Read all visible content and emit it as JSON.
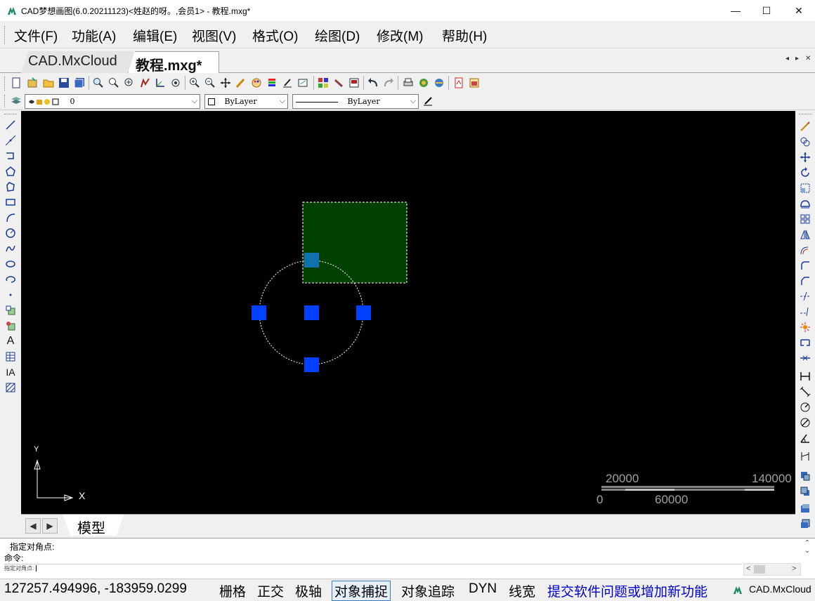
{
  "window": {
    "title": "CAD梦想画图(6.0.20211123)<姓赵的呀。,会员1> - 教程.mxg*",
    "controls": {
      "minimize": "—",
      "maximize": "☐",
      "close": "✕"
    }
  },
  "menu": {
    "items": [
      {
        "label": "文件(F)"
      },
      {
        "label": "功能(A)"
      },
      {
        "label": "编辑(E)"
      },
      {
        "label": "视图(V)"
      },
      {
        "label": "格式(O)"
      },
      {
        "label": "绘图(D)"
      },
      {
        "label": "修改(M)"
      },
      {
        "label": "帮助(H)"
      }
    ]
  },
  "tabs": {
    "items": [
      {
        "label": "CAD.MxCloud",
        "active": false
      },
      {
        "label": "教程.mxg*",
        "active": true
      }
    ],
    "nav": {
      "prev": "◂",
      "next": "▸",
      "close": "✕"
    }
  },
  "properties": {
    "layer": "0",
    "color": "ByLayer",
    "linetype": "ByLayer"
  },
  "canvas": {
    "background": "#000000",
    "rect_fill": "#004000",
    "grip_color": "#0040ff",
    "grip_hot_color": "#1070b0",
    "ucs": {
      "x_label": "X",
      "y_label": "Y"
    },
    "scale": {
      "top_labels": [
        "20000",
        "140000"
      ],
      "bottom_labels": [
        "0",
        "60000"
      ]
    }
  },
  "bottom": {
    "model_tab": "模型",
    "prev": "◀",
    "next": "▶"
  },
  "command": {
    "lines": [
      "指定对角点:",
      "命令:"
    ],
    "input_prompt": "指定对角点:"
  },
  "status": {
    "coords": "127257.494996,  -183959.0299",
    "toggles": [
      "栅格",
      "正交",
      "极轴",
      "对象捕捉",
      "对象追踪",
      "DYN",
      "线宽"
    ],
    "link": "提交软件问题或增加新功能",
    "brand": "CAD.MxCloud"
  },
  "icons": {
    "toolbar_main": [
      "new-file",
      "open-file",
      "open-folder",
      "save",
      "save-all",
      "zoom-window",
      "zoom-realtime",
      "zoom-extents",
      "pan",
      "ucs",
      "zoom-previous",
      "zoom-in",
      "zoom-out",
      "move-view",
      "brush",
      "palette",
      "layers-color",
      "match-properties",
      "rectangle-props",
      "array",
      "eraser",
      "image",
      "undo",
      "redo",
      "print",
      "render",
      "globe",
      "pdf",
      "export"
    ],
    "left_draw": [
      "line",
      "xline",
      "polyline",
      "polygon",
      "rotated-poly",
      "rectangle",
      "arc",
      "circle",
      "spline",
      "ellipse",
      "ellipse-arc",
      "point",
      "insert-block",
      "make-block",
      "text",
      "table",
      "mtext",
      "hatch"
    ],
    "right_modify": [
      "pencil",
      "copy",
      "move",
      "rotate",
      "scale",
      "stretch",
      "array",
      "mirror",
      "offset",
      "fillet",
      "chamfer",
      "trim",
      "extend",
      "explode",
      "break",
      "join",
      "dim-linear",
      "dim-aligned",
      "dim-radius",
      "dim-diameter",
      "dim-angle",
      "dim-continue",
      "layer-up",
      "layer-down",
      "bring-front",
      "send-back"
    ]
  }
}
